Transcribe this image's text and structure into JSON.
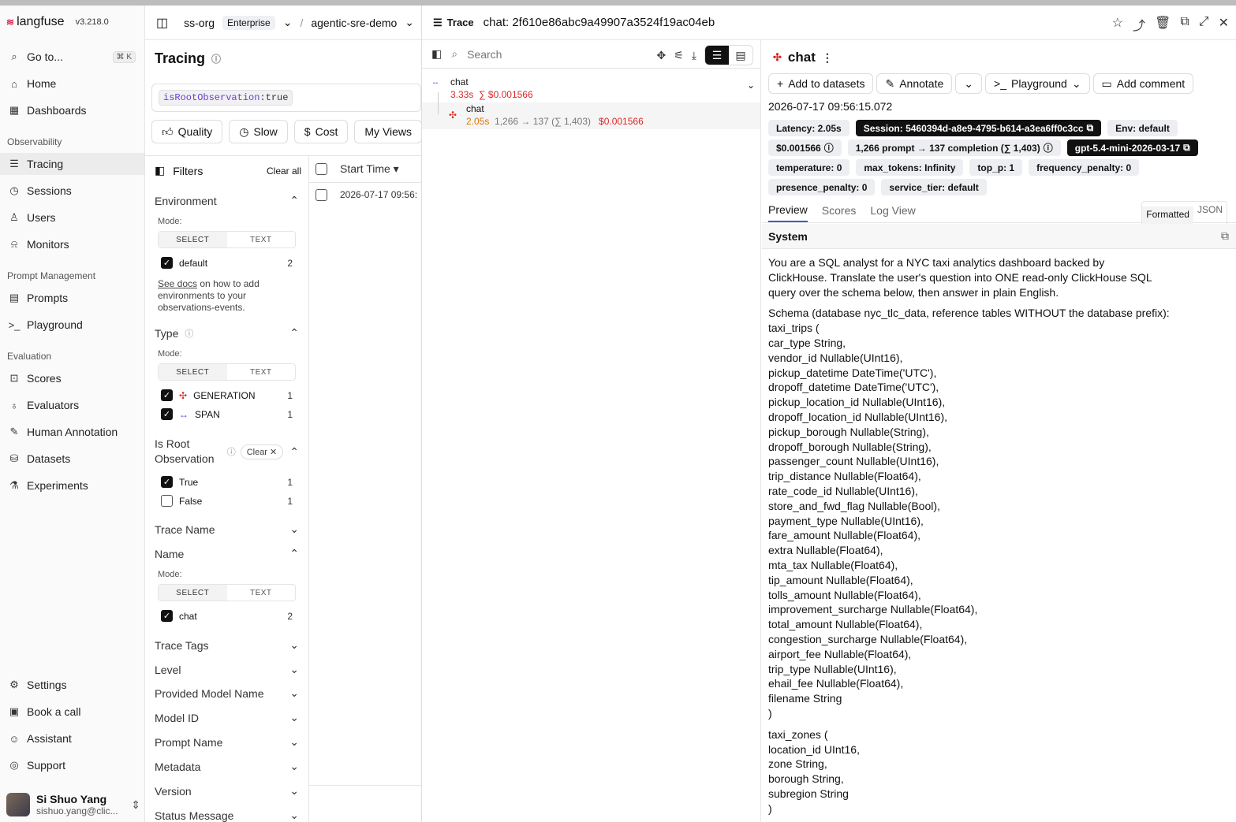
{
  "app": {
    "name": "langfuse",
    "version": "v3.218.0",
    "logo_mark": "≋"
  },
  "sidebar": {
    "goto": "Go to...",
    "goto_kbd": "⌘ K",
    "home": "Home",
    "dashboards": "Dashboards",
    "sec_observability": "Observability",
    "tracing": "Tracing",
    "sessions": "Sessions",
    "users": "Users",
    "monitors": "Monitors",
    "sec_prompt": "Prompt Management",
    "prompts": "Prompts",
    "playground": "Playground",
    "sec_eval": "Evaluation",
    "scores": "Scores",
    "evaluators": "Evaluators",
    "human_annotation": "Human Annotation",
    "datasets": "Datasets",
    "experiments": "Experiments",
    "settings": "Settings",
    "book_call": "Book a call",
    "assistant": "Assistant",
    "support": "Support",
    "user_name": "Si Shuo Yang",
    "user_email": "sishuo.yang@clic..."
  },
  "header": {
    "org": "ss-org",
    "plan": "Enterprise",
    "project": "agentic-sre-demo"
  },
  "tracing": {
    "title": "Tracing",
    "query_key": "isRootObservation",
    "query_val": ":true",
    "quick": [
      "Quality",
      "Slow",
      "Cost",
      "My Views"
    ]
  },
  "filters": {
    "title": "Filters",
    "clear_all": "Clear all",
    "mode": "Mode:",
    "select": "SELECT",
    "text": "TEXT",
    "environment": "Environment",
    "env_opt": "default",
    "env_cnt": "2",
    "see_docs": "See docs",
    "docs_rest": " on how to add environments to your observations-events.",
    "type": "Type",
    "gen": "GENERATION",
    "gen_cnt": "1",
    "span": "SPAN",
    "span_cnt": "1",
    "is_root": "Is Root Observation",
    "clear": "Clear",
    "true": "True",
    "true_cnt": "1",
    "false": "False",
    "false_cnt": "1",
    "trace_name": "Trace Name",
    "name": "Name",
    "name_opt": "chat",
    "name_cnt": "2",
    "trace_tags": "Trace Tags",
    "level": "Level",
    "provided_model": "Provided Model Name",
    "model_id": "Model ID",
    "prompt_name": "Prompt Name",
    "metadata": "Metadata",
    "version": "Version",
    "status_message": "Status Message"
  },
  "table": {
    "col": "Start Time",
    "row_time": "2026-07-17 09:56:"
  },
  "trace": {
    "label": "Trace",
    "title": "chat: 2f610e86abc9a49907a3524f19ac04eb",
    "search_placeholder": "Search",
    "root": {
      "name": "chat",
      "latency": "3.33s",
      "cost": "∑ $0.001566"
    },
    "child": {
      "name": "chat",
      "latency": "2.05s",
      "tokens": "1,266 → 137 (∑ 1,403)",
      "cost": "$0.001566"
    }
  },
  "detail": {
    "name": "chat",
    "add_datasets": "Add to datasets",
    "annotate": "Annotate",
    "playground": "Playground",
    "add_comment": "Add comment",
    "timestamp": "2026-07-17 09:56:15.072",
    "chips_row1": [
      "Latency: 2.05s",
      "Session: 5460394d-a8e9-4795-b614-a3ea6ff0c3cc",
      "Env: default"
    ],
    "chip_cost": "$0.001566",
    "chip_tokens": "1,266 prompt → 137 completion (∑ 1,403)",
    "chip_model": "gpt-5.4-mini-2026-03-17",
    "chips_row3": [
      "temperature: 0",
      "max_tokens: Infinity",
      "top_p: 1",
      "frequency_penalty: 0"
    ],
    "chips_row4": [
      "presence_penalty: 0",
      "service_tier: default"
    ],
    "tabs": [
      "Preview",
      "Scores",
      "Log View"
    ],
    "fmt_formatted": "Formatted",
    "fmt_json": "JSON",
    "system": "System",
    "para1": "You are a SQL analyst for a NYC taxi analytics dashboard backed by ClickHouse. Translate the user's question into ONE read-only ClickHouse SQL query over the schema below, then answer in plain English.",
    "schema_lines": [
      "Schema (database nyc_tlc_data, reference tables WITHOUT the database prefix):",
      "taxi_trips (",
      "car_type String,",
      "vendor_id Nullable(UInt16),",
      "pickup_datetime DateTime('UTC'),",
      "dropoff_datetime DateTime('UTC'),",
      "pickup_location_id Nullable(UInt16),",
      "dropoff_location_id Nullable(UInt16),",
      "pickup_borough Nullable(String),",
      "dropoff_borough Nullable(String),",
      "passenger_count Nullable(UInt16),",
      "trip_distance Nullable(Float64),",
      "rate_code_id Nullable(UInt16),",
      "store_and_fwd_flag Nullable(Bool),",
      "payment_type Nullable(UInt16),",
      "fare_amount Nullable(Float64),",
      "extra Nullable(Float64),",
      "mta_tax Nullable(Float64),",
      "tip_amount Nullable(Float64),",
      "tolls_amount Nullable(Float64),",
      "improvement_surcharge Nullable(Float64),",
      "total_amount Nullable(Float64),",
      "congestion_surcharge Nullable(Float64),",
      "airport_fee Nullable(Float64),",
      "trip_type Nullable(UInt16),",
      "ehail_fee Nullable(Float64),",
      "filename String",
      ")"
    ],
    "zones_lines": [
      "taxi_zones (",
      "location_id UInt16,",
      "zone String,",
      "borough String,",
      "subregion String",
      ")"
    ]
  }
}
